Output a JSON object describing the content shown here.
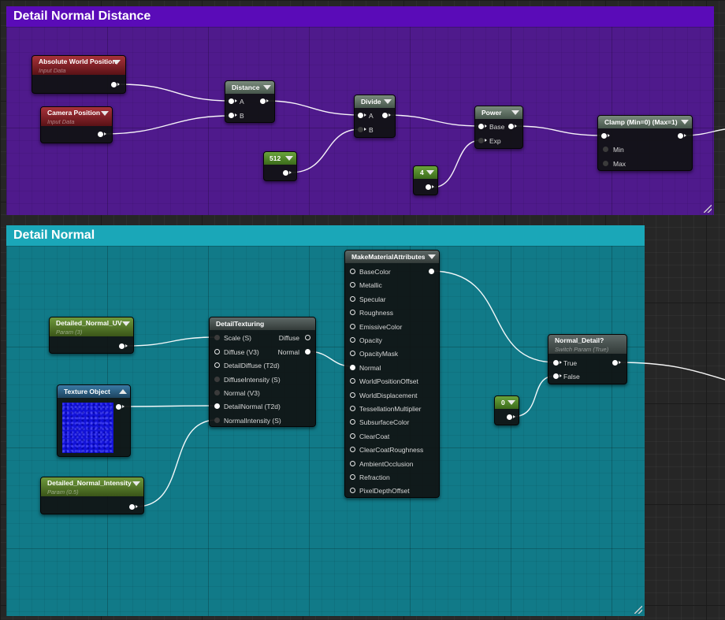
{
  "comments": {
    "distance": {
      "title": "Detail Normal Distance",
      "color": "#4f1a8c",
      "header_color": "#5a0bb8"
    },
    "normal": {
      "title": "Detail Normal",
      "color": "#117a88",
      "header_color": "#1aa7b8"
    }
  },
  "nodes": {
    "abs_world_pos": {
      "title": "Absolute World Position",
      "subtitle": "Input Data"
    },
    "camera_pos": {
      "title": "Camera Position",
      "subtitle": "Input Data"
    },
    "distance": {
      "title": "Distance",
      "pins": {
        "a": "A",
        "b": "B"
      }
    },
    "divide": {
      "title": "Divide",
      "pins": {
        "a": "A",
        "b": "B"
      }
    },
    "const_512": {
      "value": "512"
    },
    "power": {
      "title": "Power",
      "pins": {
        "base": "Base",
        "exp": "Exp"
      }
    },
    "const_4": {
      "value": "4"
    },
    "clamp": {
      "title": "Clamp (Min=0) (Max=1)",
      "pins": {
        "min": "Min",
        "max": "Max"
      }
    },
    "detailed_normal_uv": {
      "title": "Detailed_Normal_UV",
      "subtitle": "Param (3)"
    },
    "texture_object": {
      "title": "Texture Object"
    },
    "detailed_normal_intensity": {
      "title": "Detailed_Normal_Intensity",
      "subtitle": "Param (0.5)"
    },
    "detail_texturing": {
      "title": "DetailTexturing",
      "inputs": [
        "Scale (S)",
        "Diffuse (V3)",
        "DetailDiffuse (T2d)",
        "DiffuseIntensity (S)",
        "Normal (V3)",
        "DetailNormal (T2d)",
        "NormalIntensity (S)"
      ],
      "outputs": [
        "Diffuse",
        "Normal"
      ]
    },
    "make_material_attributes": {
      "title": "MakeMaterialAttributes",
      "inputs": [
        "BaseColor",
        "Metallic",
        "Specular",
        "Roughness",
        "EmissiveColor",
        "Opacity",
        "OpacityMask",
        "Normal",
        "WorldPositionOffset",
        "WorldDisplacement",
        "TessellationMultiplier",
        "SubsurfaceColor",
        "ClearCoat",
        "ClearCoatRoughness",
        "AmbientOcclusion",
        "Refraction",
        "PixelDepthOffset"
      ]
    },
    "const_0": {
      "value": "0"
    },
    "normal_detail": {
      "title": "Normal_Detail?",
      "subtitle": "Switch Param (True)",
      "pins": {
        "true": "True",
        "false": "False"
      }
    }
  },
  "colors": {
    "input_header": "#8e2830",
    "param_header": "#5a8a2c",
    "function_header": "#4d5e52",
    "texture_header": "#2f6a94",
    "preview_blue": "#1212d8"
  }
}
